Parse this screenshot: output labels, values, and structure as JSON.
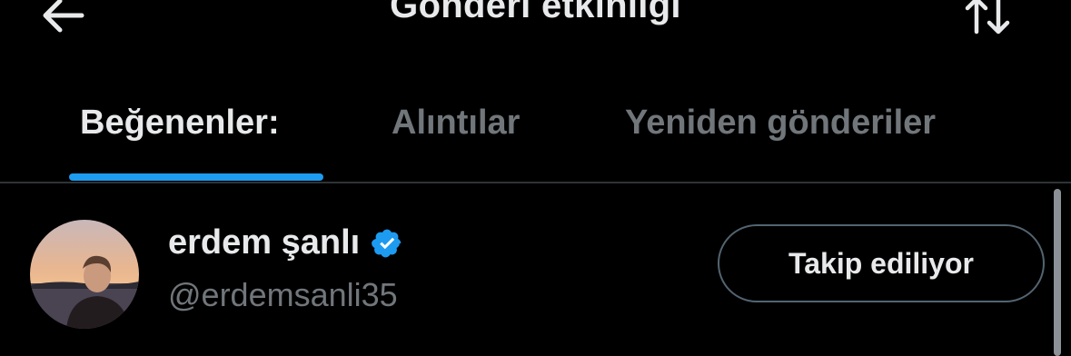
{
  "header": {
    "title": "Gönderi etkinliği",
    "back_icon": "arrow-left-icon",
    "sort_icon": "sort-arrows-icon"
  },
  "tabs": [
    {
      "label": "Beğenenler:",
      "active": true
    },
    {
      "label": "Alıntılar",
      "active": false
    },
    {
      "label": "Yeniden gönderiler",
      "active": false
    }
  ],
  "users": [
    {
      "display_name": "erdem şanlı",
      "handle": "@erdemsanli35",
      "verified": true,
      "follow_label": "Takip ediliyor"
    }
  ],
  "colors": {
    "accent": "#1d9bf0",
    "text_primary": "#e7e9ea",
    "text_secondary": "#71767b",
    "background": "#000000"
  }
}
